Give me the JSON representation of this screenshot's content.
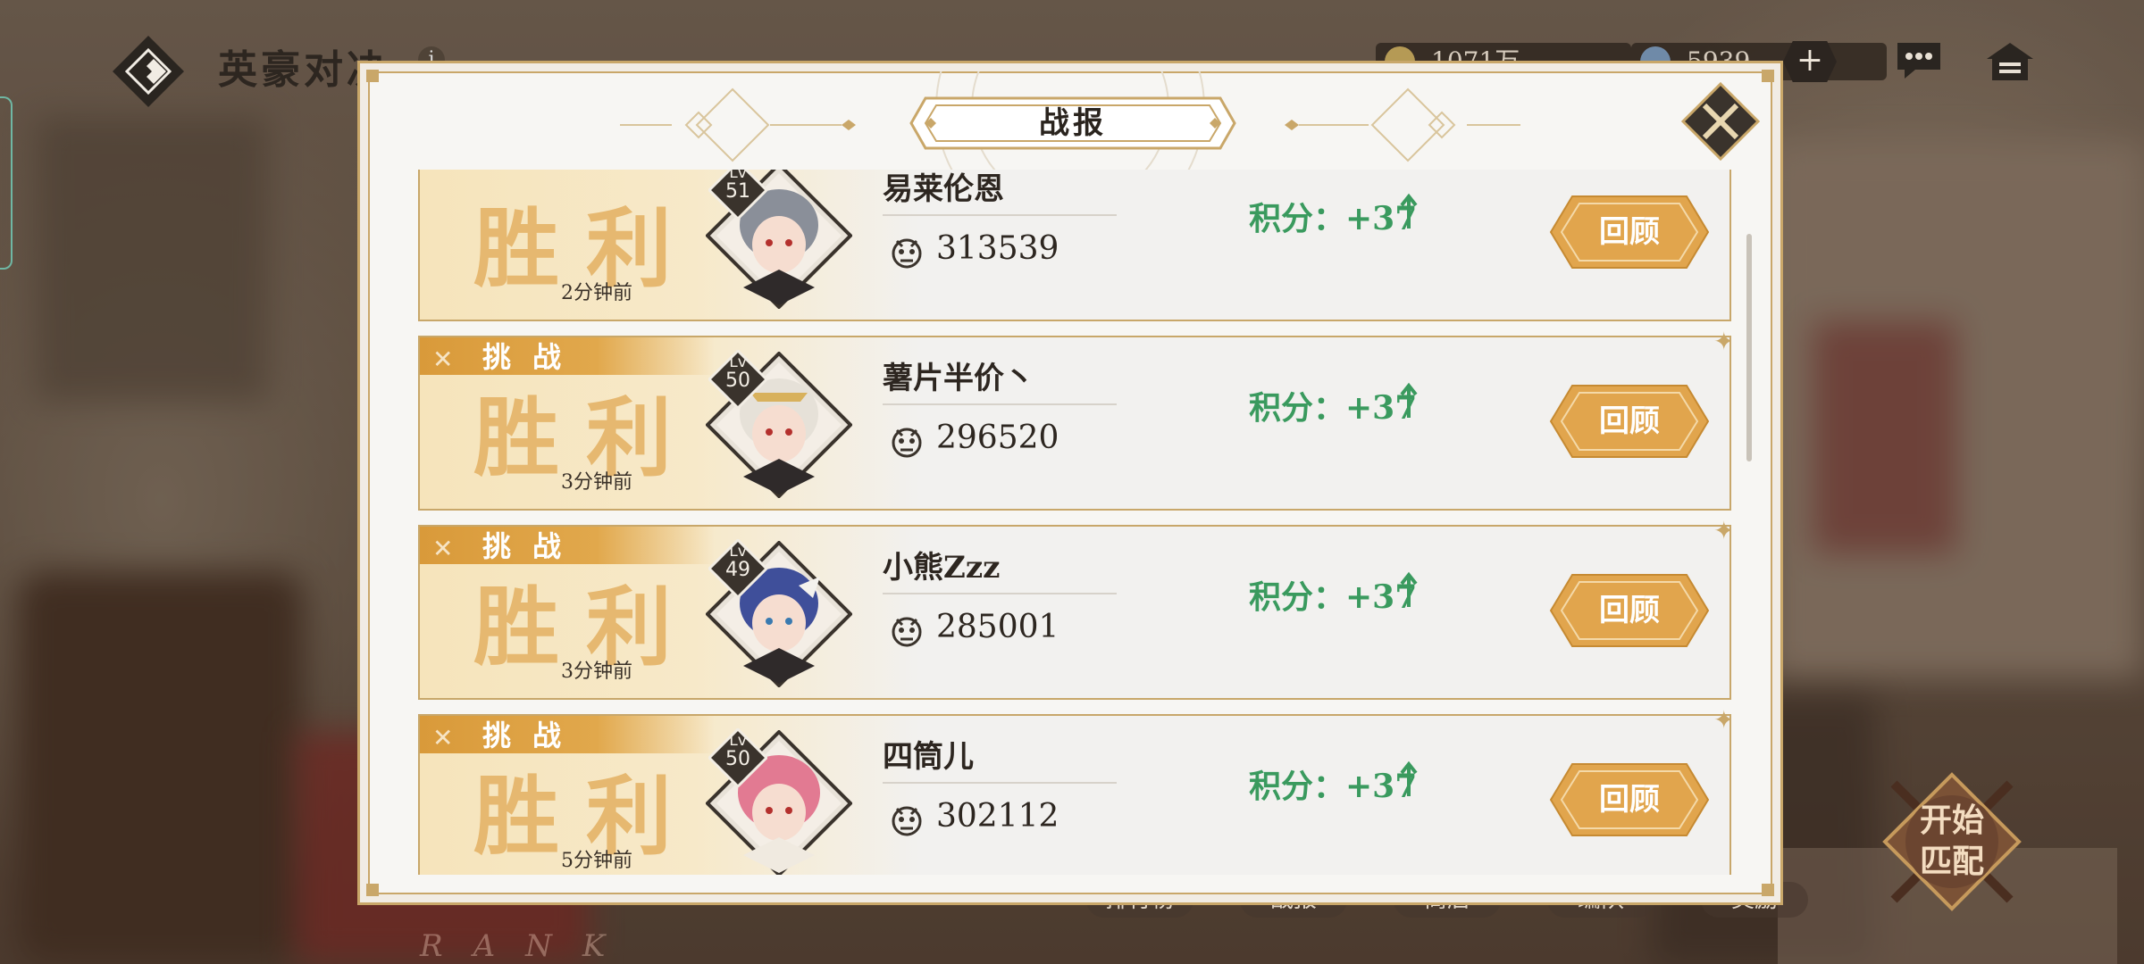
{
  "top_bar": {
    "game_title": "英豪对决",
    "info_icon": "i",
    "currency_1": {
      "icon": "gold-coin-icon",
      "value": "1071万"
    },
    "currency_2": {
      "icon": "diamond-gem-icon",
      "value": "5939"
    },
    "plus_label": "+"
  },
  "bottom_nav": {
    "items": [
      "排行榜",
      "战报",
      "商店",
      "编队",
      "奖励"
    ],
    "rank_text": "RANK",
    "match_button": {
      "line1": "开始",
      "line2": "匹配"
    }
  },
  "dialog": {
    "title": "战报",
    "entries": [
      {
        "challenge_tag": "",
        "result": "胜利",
        "time_ago": "2分钟前",
        "level_prefix": "Lv",
        "level": "51",
        "player_name": "易莱伦恩",
        "power": "313539",
        "score": "积分：+37",
        "review_label": "回顾",
        "hair_color": "#8a8f99"
      },
      {
        "challenge_tag": "挑战",
        "result": "胜利",
        "time_ago": "3分钟前",
        "level_prefix": "Lv",
        "level": "50",
        "player_name": "薯片半价丶",
        "power": "296520",
        "score": "积分：+37",
        "review_label": "回顾",
        "hair_color": "#e6e1d8"
      },
      {
        "challenge_tag": "挑战",
        "result": "胜利",
        "time_ago": "3分钟前",
        "level_prefix": "Lv",
        "level": "49",
        "player_name": "小熊Zzz",
        "power": "285001",
        "score": "积分：+37",
        "review_label": "回顾",
        "hair_color": "#3f4f9a"
      },
      {
        "challenge_tag": "挑战",
        "result": "胜利",
        "time_ago": "5分钟前",
        "level_prefix": "Lv",
        "level": "50",
        "player_name": "四筒儿",
        "power": "302112",
        "score": "积分：+37",
        "review_label": "回顾",
        "hair_color": "#e27a92"
      }
    ]
  },
  "colors": {
    "gold": "#c9a769",
    "score_green": "#3a9a5e",
    "victory_text": "#e6b870",
    "review_button": "#e1a54d"
  }
}
